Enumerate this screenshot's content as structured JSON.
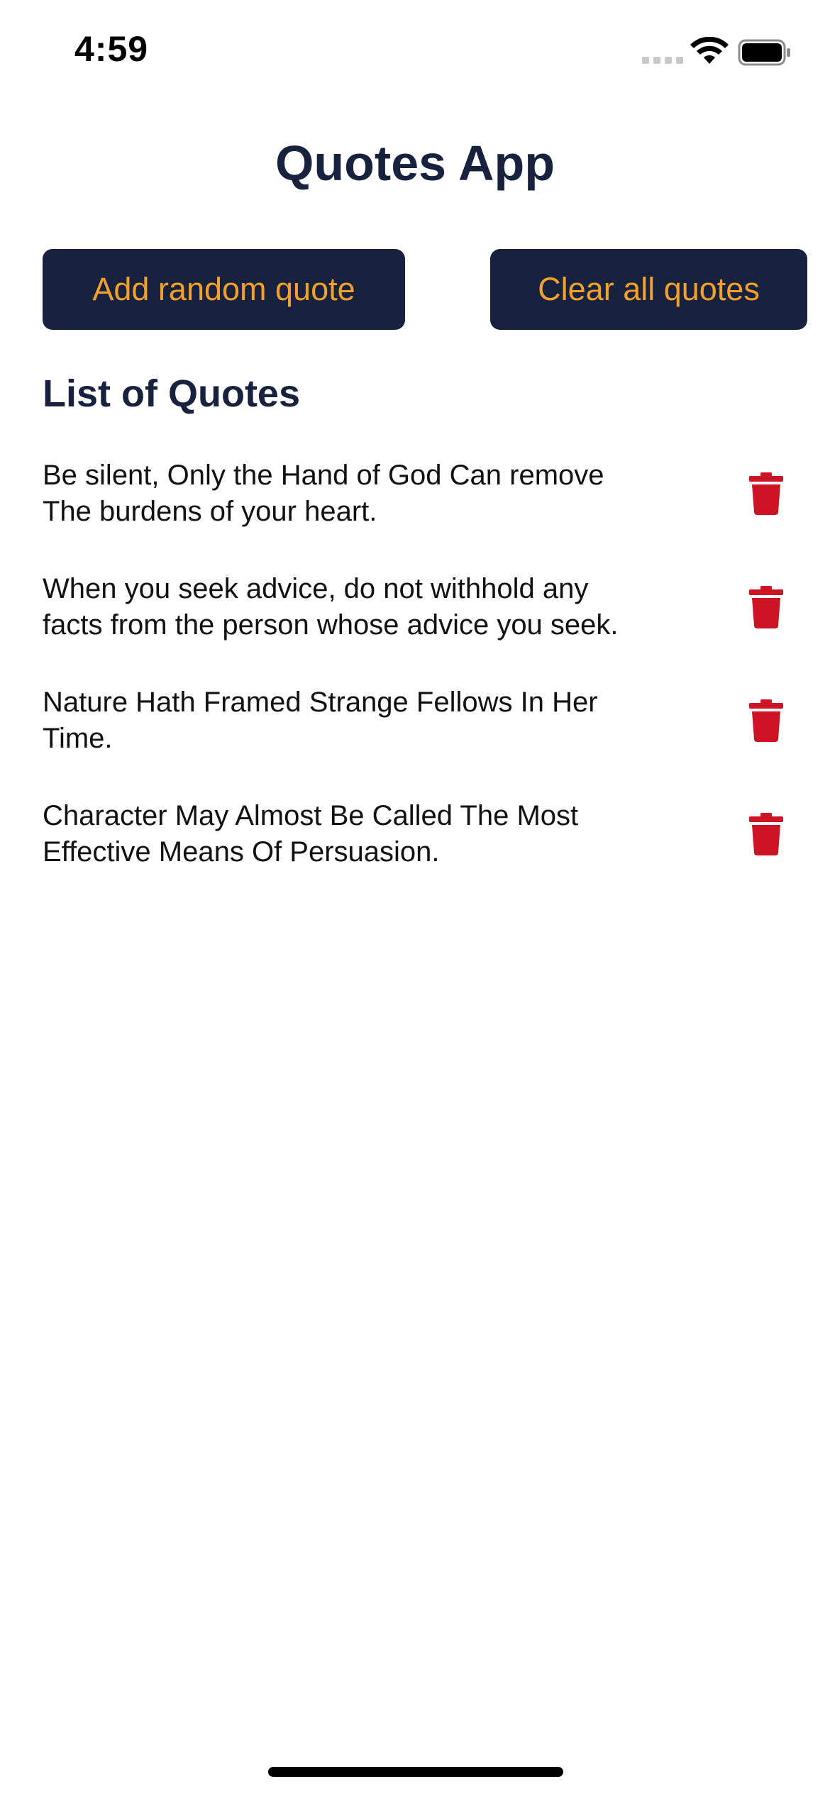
{
  "status_bar": {
    "time": "4:59"
  },
  "app": {
    "title": "Quotes App"
  },
  "actions": {
    "add_label": "Add random quote",
    "clear_label": "Clear all quotes"
  },
  "list": {
    "heading": "List of Quotes",
    "quotes": [
      {
        "text": "Be silent, Only the Hand of God Can remove The burdens of your heart."
      },
      {
        "text": "When you seek advice, do not withhold any facts from the person whose advice you seek."
      },
      {
        "text": "Nature Hath Framed Strange Fellows In Her Time."
      },
      {
        "text": "Character May Almost Be Called The Most Effective Means Of Persuasion."
      }
    ],
    "delete_icon": "trash-icon"
  },
  "colors": {
    "navy": "#18223f",
    "accent_orange": "#f2a12b",
    "delete_red": "#cc1424",
    "background": "#ffffff"
  }
}
